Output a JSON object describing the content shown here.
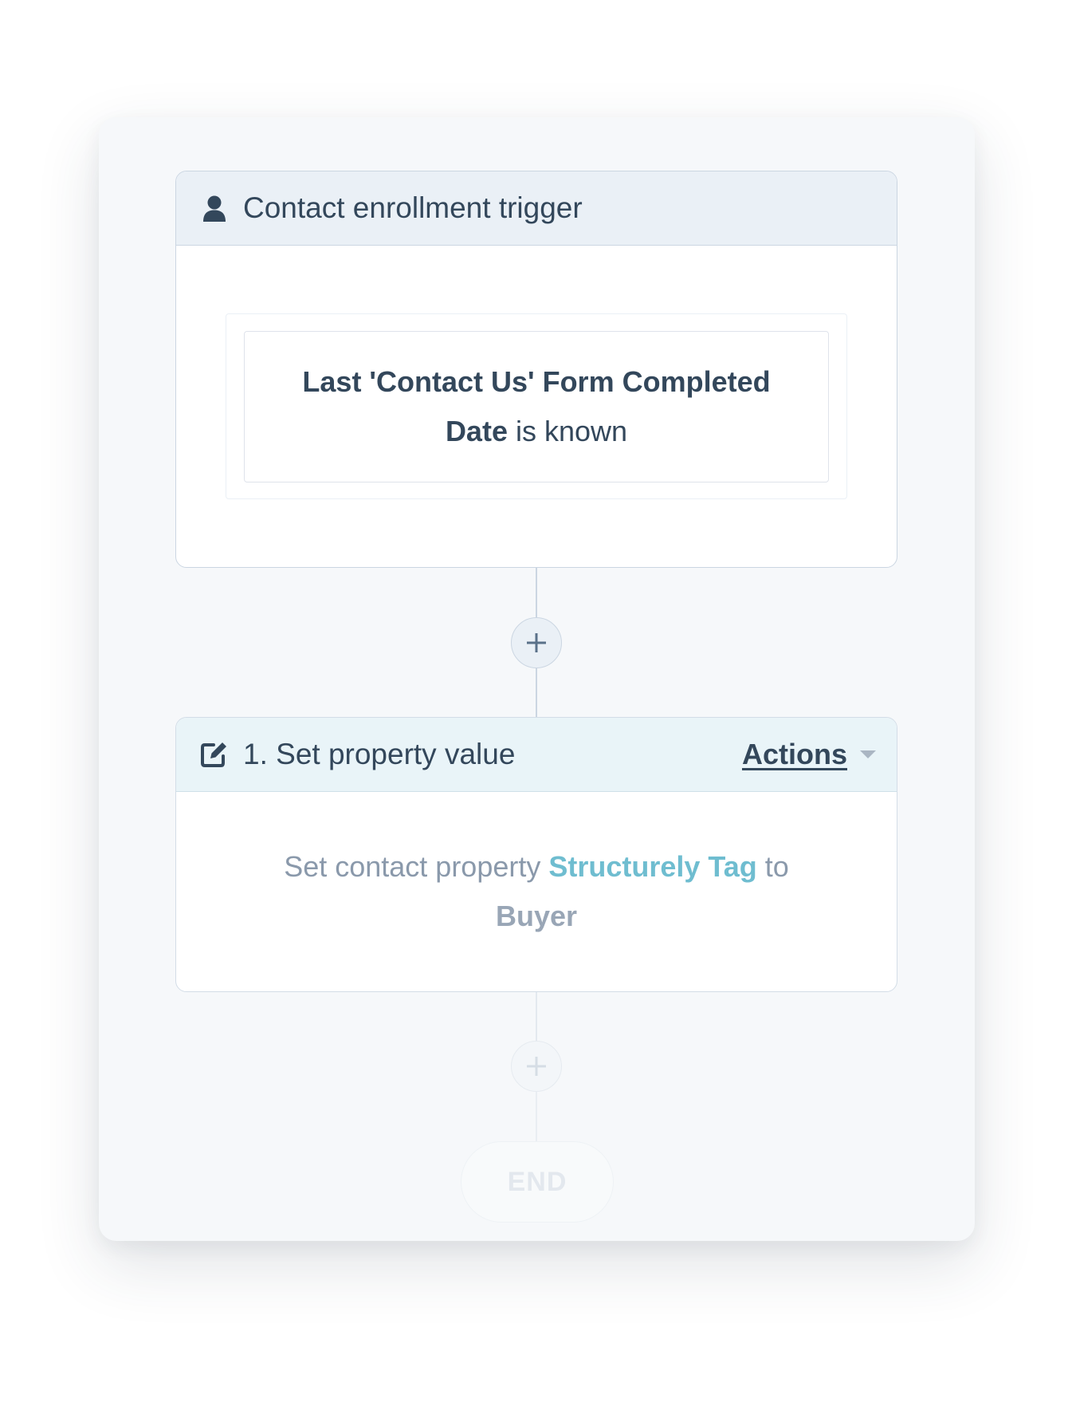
{
  "trigger": {
    "title": "Contact enrollment trigger",
    "icon": "user-icon",
    "filter": {
      "property": "Last 'Contact Us' Form Completed Date",
      "operator": "is known"
    }
  },
  "action": {
    "title": "1. Set property value",
    "icon": "edit-icon",
    "menu_label": "Actions",
    "description_prefix": "Set contact property",
    "property": "Structurely Tag",
    "connector_word": "to",
    "value": "Buyer"
  },
  "add_step_symbol": "+",
  "end_label": "END",
  "colors": {
    "trigger_header_bg": "#eaf0f6",
    "action_header_bg": "#e9f4f8",
    "property_link": "#6fbdd0",
    "text_primary": "#33475b",
    "text_muted": "#8a99ab"
  }
}
